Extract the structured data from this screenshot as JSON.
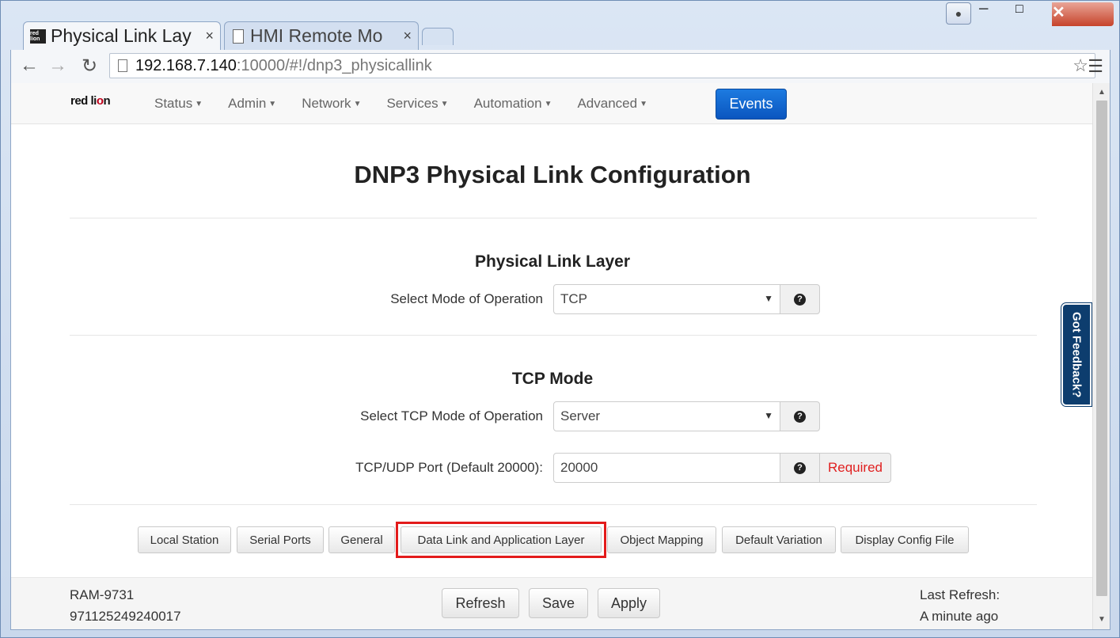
{
  "browser": {
    "tabs": [
      {
        "title": "Physical Link Lay",
        "close": "×",
        "active": true
      },
      {
        "title": "HMI Remote Mo",
        "close": "×",
        "active": false
      }
    ],
    "url_host": "192.168.7.140",
    "url_path": ":10000/#!/dnp3_physicallink",
    "favicon_text": "red lion"
  },
  "navbar": {
    "logo_main": "red li",
    "logo_accent": "o",
    "logo_end": "n",
    "menu": [
      {
        "label": "Status"
      },
      {
        "label": "Admin"
      },
      {
        "label": "Network"
      },
      {
        "label": "Services"
      },
      {
        "label": "Automation"
      },
      {
        "label": "Advanced"
      }
    ],
    "events_label": "Events",
    "brand_color": "#0a56bf"
  },
  "page": {
    "title": "DNP3 Physical Link Configuration",
    "physical_section": {
      "title": "Physical Link Layer",
      "mode_label": "Select Mode of Operation",
      "mode_value": "TCP"
    },
    "tcp_section": {
      "title": "TCP Mode",
      "tcp_mode_label": "Select TCP Mode of Operation",
      "tcp_mode_value": "Server",
      "port_label": "TCP/UDP Port (Default 20000):",
      "port_value": "20000",
      "required_label": "Required"
    },
    "help_glyph": "?",
    "nav_buttons": [
      {
        "label": "Local Station"
      },
      {
        "label": "Serial Ports"
      },
      {
        "label": "General"
      },
      {
        "label": "Data Link and Application Layer",
        "highlighted": true
      },
      {
        "label": "Object Mapping"
      },
      {
        "label": "Default Variation"
      },
      {
        "label": "Display Config File"
      }
    ],
    "highlight_color": "#e31b1b"
  },
  "footer": {
    "device_model": "RAM-9731",
    "device_serial": "971125249240017",
    "refresh_label": "Refresh",
    "save_label": "Save",
    "apply_label": "Apply",
    "last_refresh_label": "Last Refresh:",
    "last_refresh_value": "A minute ago"
  },
  "feedback": {
    "label": "Got Feedback?"
  }
}
